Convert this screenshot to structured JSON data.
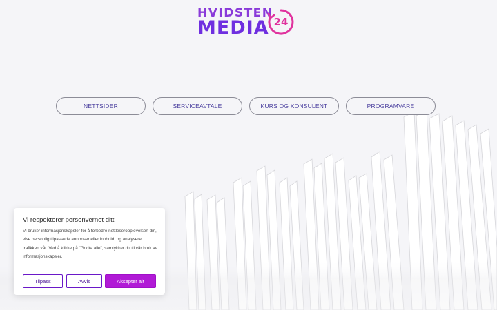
{
  "logo": {
    "line1": "HVIDSTEN",
    "line2": "MEDIA",
    "badge": "24"
  },
  "nav": {
    "items": [
      {
        "label": "NETTSIDER"
      },
      {
        "label": "SERVICEAVTALE"
      },
      {
        "label": "KURS OG KONSULENT"
      },
      {
        "label": "PROGRAMVARE"
      }
    ]
  },
  "cookie": {
    "title": "Vi respekterer personvernet ditt",
    "text": "Vi bruker informasjonskapsler for å forbedre nettleseropplevelsen din, vise personlig tilpassede annonser eller innhold, og analysere trafikken vår. Ved å klikke på \"Godta alle\", samtykker du til vår bruk av informasjonskapsler.",
    "customize_label": "Tilpass",
    "reject_label": "Avvis",
    "accept_label": "Aksepter alt"
  },
  "colors": {
    "brand_purple": "#6f2fe0",
    "badge_pink": "#e0339e",
    "accept_button": "#b11ad6",
    "nav_text": "#4a3f9e"
  }
}
